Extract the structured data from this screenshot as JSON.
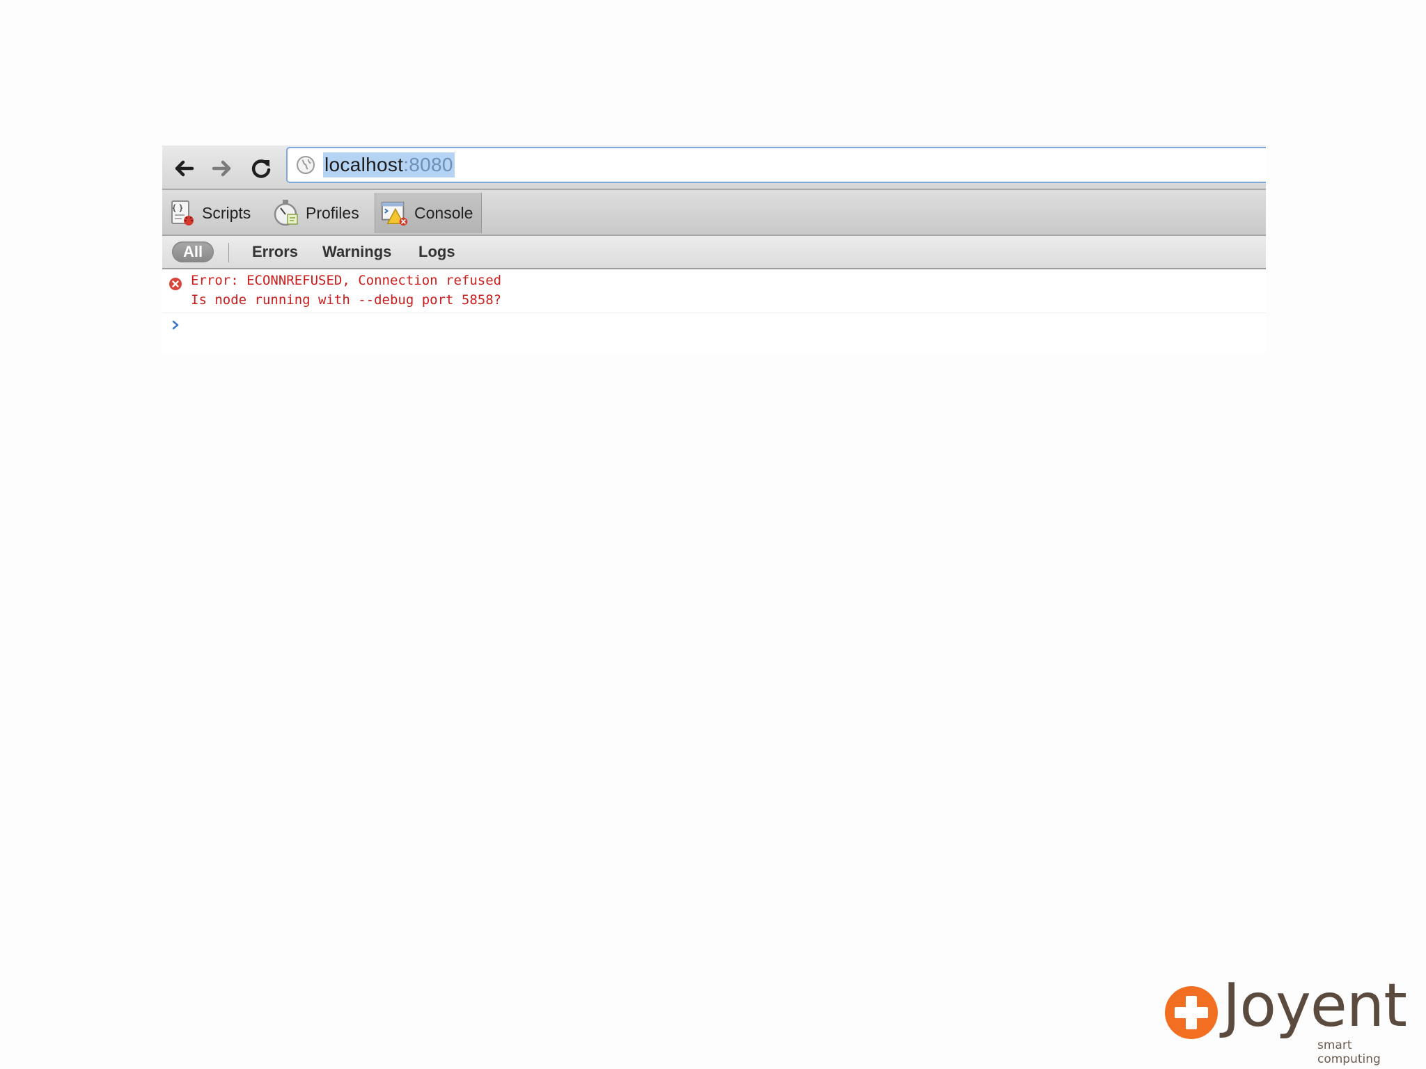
{
  "browser": {
    "url_host": "localhost",
    "url_port": ":8080",
    "icons": {
      "back": "back-arrow-icon",
      "forward": "forward-arrow-icon",
      "reload": "reload-icon",
      "site": "globe-icon"
    }
  },
  "devtools": {
    "panels": [
      {
        "label": "Scripts",
        "icon": "scripts-icon"
      },
      {
        "label": "Profiles",
        "icon": "profiles-icon"
      },
      {
        "label": "Console",
        "icon": "console-icon",
        "selected": true
      }
    ],
    "filters": {
      "all": "All",
      "errors": "Errors",
      "warnings": "Warnings",
      "logs": "Logs"
    },
    "console": {
      "error_lines": [
        "Error: ECONNREFUSED, Connection refused",
        "Is node running with --debug port 5858?"
      ]
    }
  },
  "brand": {
    "name": "Joyent",
    "tagline": "smart computing"
  },
  "colors": {
    "error_text": "#cc1b1b",
    "brand_orange": "#f26f21",
    "brand_text": "#5b4a3e",
    "url_selection": "#b5d3f3"
  }
}
